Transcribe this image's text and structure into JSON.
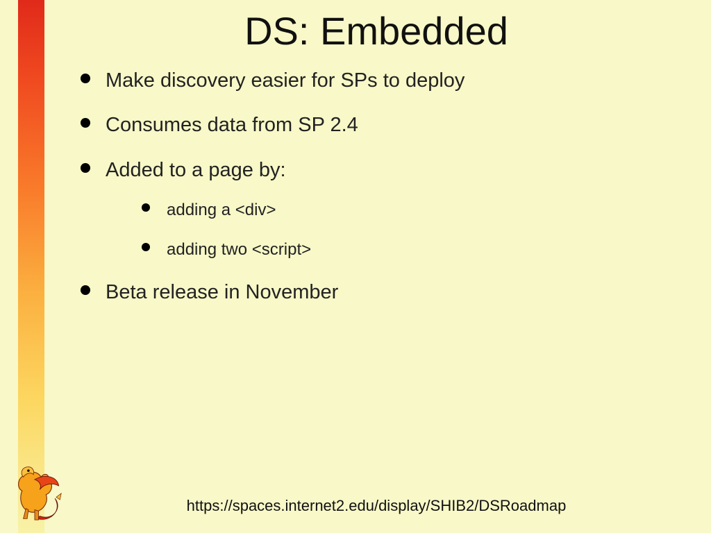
{
  "title": "DS: Embedded",
  "bullets": [
    {
      "text": "Make discovery easier for SPs to deploy"
    },
    {
      "text": "Consumes data from SP 2.4"
    },
    {
      "text": "Added to a page by:",
      "sub": [
        "adding a <div>",
        "adding two <script>"
      ]
    },
    {
      "text": "Beta release in November"
    }
  ],
  "footer_url": "https://spaces.internet2.edu/display/SHIB2/DSRoadmap"
}
